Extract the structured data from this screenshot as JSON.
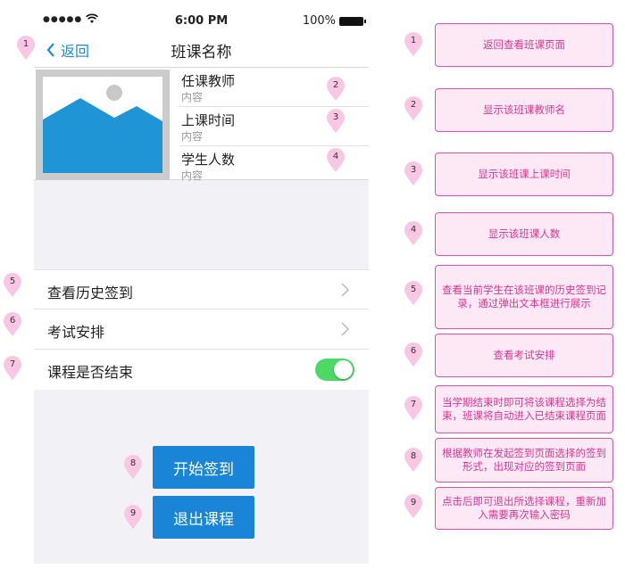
{
  "status_bar": {
    "signal": "●●●●●",
    "time": "6:00 PM",
    "battery": "100%"
  },
  "nav": {
    "back_label": "返回",
    "title": "班课名称"
  },
  "info_rows": [
    {
      "label": "任课教师",
      "value": "内容"
    },
    {
      "label": "上课时间",
      "value": "内容"
    },
    {
      "label": "学生人数",
      "value": "内容"
    }
  ],
  "menu": {
    "history": "查看历史签到",
    "exam": "考试安排",
    "ended": "课程是否结束",
    "ended_toggle_on": true
  },
  "buttons": {
    "start_sign": "开始签到",
    "quit_course": "退出课程"
  },
  "markers": [
    "1",
    "2",
    "3",
    "4",
    "5",
    "6",
    "7",
    "8",
    "9"
  ],
  "notes": [
    {
      "num": "1",
      "text": "返回查看班课页面"
    },
    {
      "num": "2",
      "text": "显示该班课教师名"
    },
    {
      "num": "3",
      "text": "显示该班课上课时间"
    },
    {
      "num": "4",
      "text": "显示该班课人数"
    },
    {
      "num": "5",
      "text": "查看当前学生在该班课的历史签到记录，通过弹出文本框进行展示"
    },
    {
      "num": "6",
      "text": "查看考试安排"
    },
    {
      "num": "7",
      "text": "当学期结束时即可将该课程选择为结束，班课将自动进入已结束课程页面"
    },
    {
      "num": "8",
      "text": "根据教师在发起签到页面选择的签到形式，出现对应的签到页面"
    },
    {
      "num": "9",
      "text": "点击后即可退出所选择课程，重新加入需要再次输入密码"
    }
  ],
  "colors": {
    "accent": "#1a84d6",
    "toggle_on": "#4cd964",
    "note_border": "#e44fa8",
    "note_bg": "#fde8f5",
    "note_text": "#e0338f",
    "pin": "#f9c6e4"
  }
}
